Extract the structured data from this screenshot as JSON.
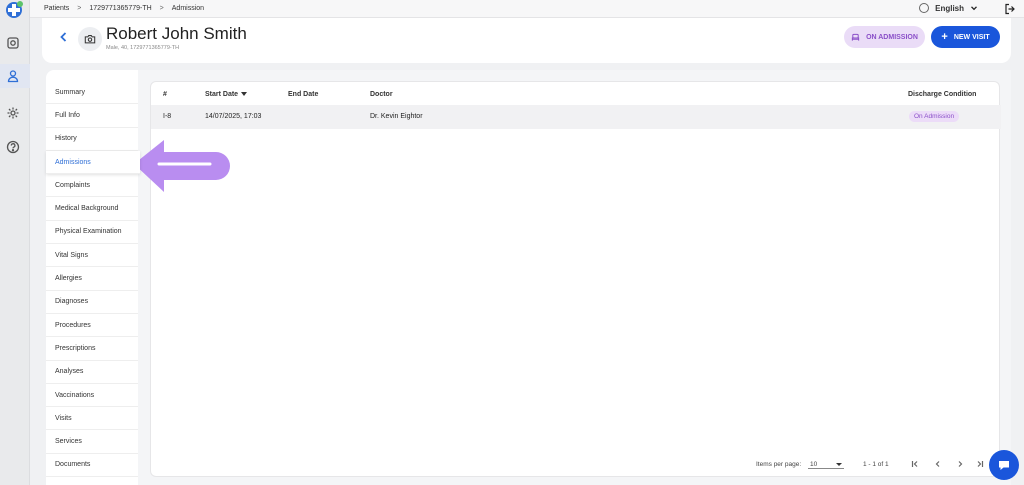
{
  "breadcrumb": [
    "Patients",
    "1729771365779-TH",
    "Admission"
  ],
  "language": "English",
  "patient": {
    "name": "Robert John Smith",
    "subtitle": "Male, 40, 1729771365779-TH"
  },
  "actions": {
    "status_label": "ON ADMISSION",
    "new_visit_label": "NEW VISIT"
  },
  "menu": [
    "Summary",
    "Full Info",
    "History",
    "Admissions",
    "Complaints",
    "Medical Background",
    "Physical Examination",
    "Vital Signs",
    "Allergies",
    "Diagnoses",
    "Procedures",
    "Prescriptions",
    "Analyses",
    "Vaccinations",
    "Visits",
    "Services",
    "Documents"
  ],
  "active_menu": "Admissions",
  "table": {
    "columns": {
      "num": "#",
      "start": "Start Date",
      "end": "End Date",
      "doctor": "Doctor",
      "discharge": "Discharge Condition"
    },
    "rows": [
      {
        "num": "I-8",
        "start": "14/07/2025, 17:03",
        "end": "",
        "doctor": "Dr. Kevin Eightor",
        "discharge": "On Admission"
      }
    ]
  },
  "pagination": {
    "items_per_page_label": "Items per page:",
    "items_per_page": "10",
    "range": "1 - 1 of 1"
  },
  "colors": {
    "primary": "#1a56db",
    "admission_badge_bg": "#ecdcf8",
    "admission_badge_text": "#8a4fc8",
    "arrow": "#b98df0"
  }
}
